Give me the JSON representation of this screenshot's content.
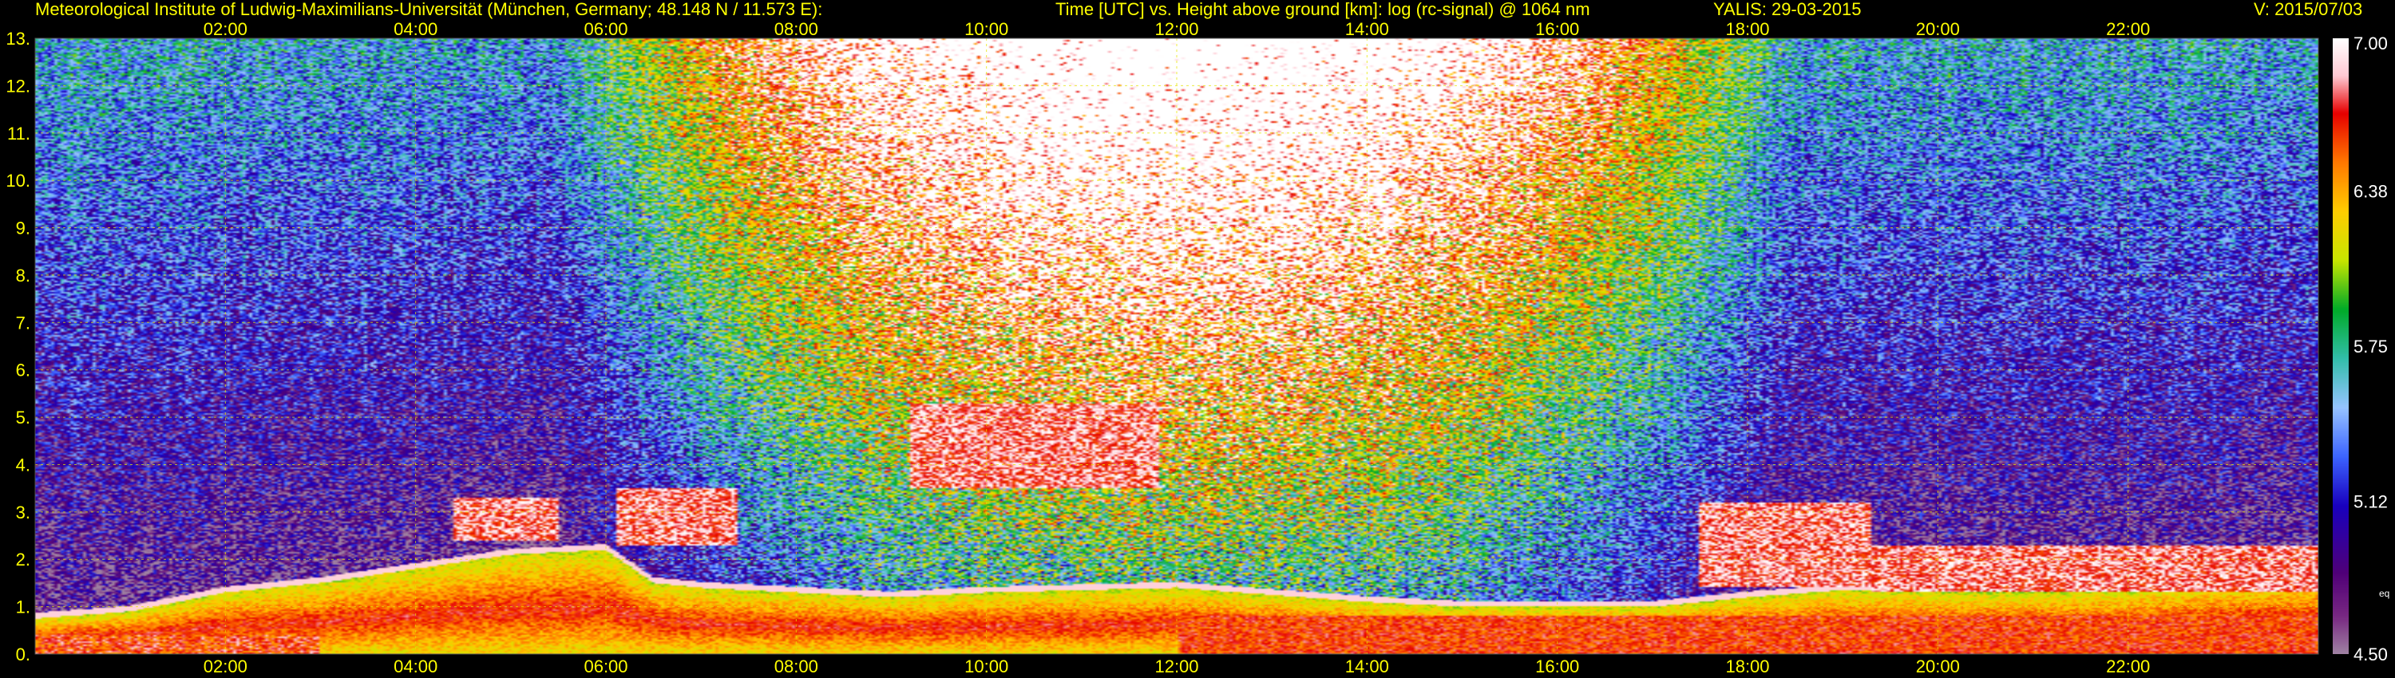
{
  "header": {
    "left": "Meteorological Institute of Ludwig-Maximilians-Universität (München, Germany; 48.148 N / 11.573 E):",
    "center": "Time [UTC] vs. Height above ground [km]: log (rc-signal) @ 1064 nm",
    "station": "YALIS: 29-03-2015",
    "version": "V: 2015/07/03"
  },
  "chart_data": {
    "type": "heatmap",
    "title": "Time [UTC] vs. Height above ground [km]: log (rc-signal) @ 1064 nm",
    "x_ticks": [
      "02:00",
      "04:00",
      "06:00",
      "08:00",
      "10:00",
      "12:00",
      "14:00",
      "16:00",
      "18:00",
      "20:00",
      "22:00"
    ],
    "x_range_hours": [
      0,
      24
    ],
    "y_ticks": [
      "0.",
      "1.",
      "2.",
      "3.",
      "4.",
      "5.",
      "6.",
      "7.",
      "8.",
      "9.",
      "10.",
      "11.",
      "12.",
      "13."
    ],
    "y_range_km": [
      0,
      13
    ],
    "grid": true,
    "colorbar": {
      "labels": [
        "7.00",
        "6.38",
        "5.75",
        "5.12",
        "4.50"
      ],
      "range": [
        4.5,
        7.0
      ],
      "note": "eq"
    },
    "boundary_layer_top_km": [
      [
        0.0,
        0.75
      ],
      [
        1.0,
        0.9
      ],
      [
        2.0,
        1.3
      ],
      [
        3.0,
        1.5
      ],
      [
        4.0,
        1.8
      ],
      [
        5.0,
        2.1
      ],
      [
        6.0,
        2.2
      ],
      [
        6.5,
        1.5
      ],
      [
        7.0,
        1.4
      ],
      [
        8.0,
        1.3
      ],
      [
        9.0,
        1.2
      ],
      [
        10.0,
        1.3
      ],
      [
        11.0,
        1.35
      ],
      [
        12.0,
        1.4
      ],
      [
        13.0,
        1.25
      ],
      [
        14.0,
        1.1
      ],
      [
        15.0,
        1.0
      ],
      [
        16.0,
        1.0
      ],
      [
        17.0,
        1.0
      ],
      [
        18.0,
        1.2
      ],
      [
        19.0,
        1.35
      ],
      [
        20.0,
        1.3
      ],
      [
        21.0,
        1.3
      ],
      [
        22.0,
        1.35
      ],
      [
        23.0,
        1.5
      ],
      [
        24.0,
        1.6
      ]
    ],
    "cloud_layers": [
      {
        "start_h": 4.4,
        "end_h": 5.5,
        "base_km": 2.4,
        "top_km": 3.3
      },
      {
        "start_h": 6.1,
        "end_h": 7.4,
        "base_km": 2.3,
        "top_km": 3.5
      },
      {
        "start_h": 9.2,
        "end_h": 11.8,
        "base_km": 3.5,
        "top_km": 5.3
      },
      {
        "start_h": 17.5,
        "end_h": 19.3,
        "base_km": 1.4,
        "top_km": 3.2
      },
      {
        "start_h": 19.3,
        "end_h": 24.0,
        "base_km": 1.3,
        "top_km": 2.3
      }
    ]
  }
}
